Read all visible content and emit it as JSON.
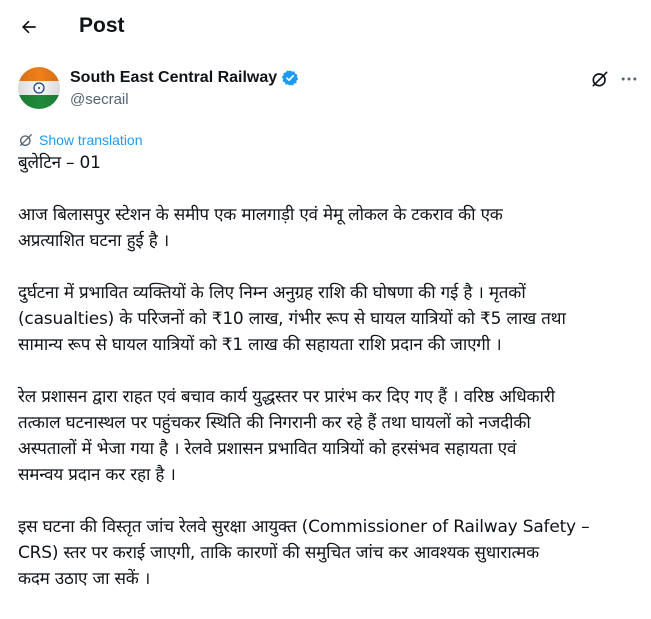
{
  "header": {
    "title": "Post",
    "back_icon": "arrow-left-icon"
  },
  "author": {
    "display_name": "South East Central Railway",
    "handle": "@secrail",
    "verified": true,
    "verified_color": "#1d9bf0",
    "avatar": "indian-flag-avatar"
  },
  "actions": {
    "grok_icon": "grok-icon",
    "more_icon": "more-horizontal-icon"
  },
  "translation": {
    "label": "Show translation",
    "icon": "translate-icon",
    "color": "#1d9bf0"
  },
  "post": {
    "lines": [
      "बुलेटिन – 01",
      "",
      "आज बिलासपुर स्टेशन के समीप एक मालगाड़ी एवं मेमू लोकल के टकराव की एक",
      "अप्रत्याशित घटना हुई है ।",
      "",
      " दुर्घटना में प्रभावित व्यक्तियों के लिए निम्न अनुग्रह राशि की घोषणा की गई है ।  मृतकों",
      "(casualties) के परिजनों को ₹10 लाख, गंभीर रूप से घायल यात्रियों को ₹5 लाख तथा",
      "सामान्य रूप से घायल यात्रियों को ₹1 लाख की सहायता राशि प्रदान की जाएगी ।",
      "",
      "रेल प्रशासन द्वारा राहत एवं बचाव कार्य युद्धस्तर पर प्रारंभ कर दिए गए हैं । वरिष्ठ अधिकारी",
      "तत्काल घटनास्थल पर पहुंचकर स्थिति की निगरानी कर रहे हैं तथा घायलों को नजदीकी",
      "अस्पतालों में भेजा गया है । रेलवे प्रशासन प्रभावित यात्रियों को हरसंभव सहायता एवं",
      "समन्वय प्रदान कर रहा है ।",
      "",
      "इस घटना की विस्तृत जांच रेलवे सुरक्षा आयुक्त (Commissioner of Railway Safety –",
      "CRS) स्तर पर कराई जाएगी, ताकि कारणों की समुचित जांच कर आवश्यक सुधारात्मक",
      "कदम उठाए जा सकें ।"
    ]
  }
}
